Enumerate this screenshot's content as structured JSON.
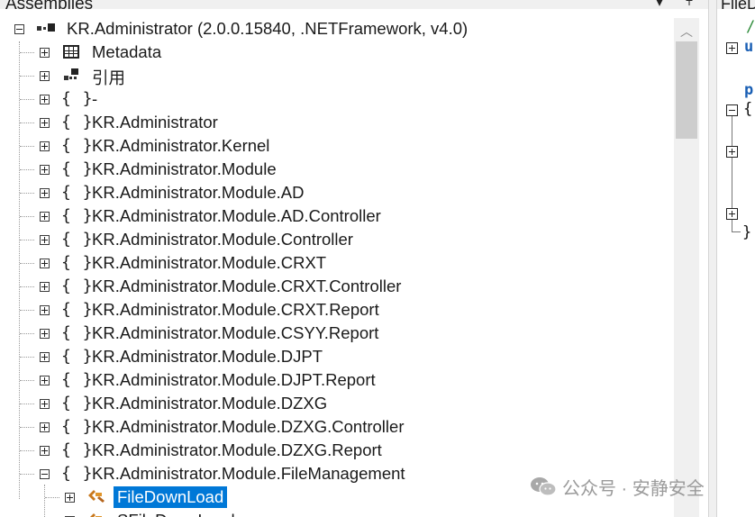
{
  "left_panel": {
    "title": "Assemblies",
    "menu_button": "▾",
    "pin_button": "📌"
  },
  "right_panel": {
    "title": "FileD",
    "code": [
      "/",
      "u",
      "p",
      "{",
      "}"
    ]
  },
  "tree": {
    "root": {
      "label": "KR.Administrator (2.0.0.15840, .NETFramework, v4.0)",
      "icon": "assembly-icon",
      "expanded": true
    },
    "children": [
      {
        "label": "Metadata",
        "icon": "metadata-icon",
        "glyph": "▥"
      },
      {
        "label": "引用",
        "icon": "references-icon",
        "glyph": "▞"
      },
      {
        "label": "-",
        "icon": "namespace-icon",
        "glyph": "{ }"
      },
      {
        "label": "KR.Administrator",
        "icon": "namespace-icon",
        "glyph": "{ }"
      },
      {
        "label": "KR.Administrator.Kernel",
        "icon": "namespace-icon",
        "glyph": "{ }"
      },
      {
        "label": "KR.Administrator.Module",
        "icon": "namespace-icon",
        "glyph": "{ }"
      },
      {
        "label": "KR.Administrator.Module.AD",
        "icon": "namespace-icon",
        "glyph": "{ }"
      },
      {
        "label": "KR.Administrator.Module.AD.Controller",
        "icon": "namespace-icon",
        "glyph": "{ }"
      },
      {
        "label": "KR.Administrator.Module.Controller",
        "icon": "namespace-icon",
        "glyph": "{ }"
      },
      {
        "label": "KR.Administrator.Module.CRXT",
        "icon": "namespace-icon",
        "glyph": "{ }"
      },
      {
        "label": "KR.Administrator.Module.CRXT.Controller",
        "icon": "namespace-icon",
        "glyph": "{ }"
      },
      {
        "label": "KR.Administrator.Module.CRXT.Report",
        "icon": "namespace-icon",
        "glyph": "{ }"
      },
      {
        "label": "KR.Administrator.Module.CSYY.Report",
        "icon": "namespace-icon",
        "glyph": "{ }"
      },
      {
        "label": "KR.Administrator.Module.DJPT",
        "icon": "namespace-icon",
        "glyph": "{ }"
      },
      {
        "label": "KR.Administrator.Module.DJPT.Report",
        "icon": "namespace-icon",
        "glyph": "{ }"
      },
      {
        "label": "KR.Administrator.Module.DZXG",
        "icon": "namespace-icon",
        "glyph": "{ }"
      },
      {
        "label": "KR.Administrator.Module.DZXG.Controller",
        "icon": "namespace-icon",
        "glyph": "{ }"
      },
      {
        "label": "KR.Administrator.Module.DZXG.Report",
        "icon": "namespace-icon",
        "glyph": "{ }"
      },
      {
        "label": "KR.Administrator.Module.FileManagement",
        "icon": "namespace-icon",
        "glyph": "{ }",
        "expanded": true
      }
    ],
    "class_items": [
      {
        "label": "FileDownLoad",
        "icon": "class-icon",
        "selected": true
      },
      {
        "label": "SFileDownLoad",
        "icon": "class-icon"
      }
    ]
  },
  "watermark": {
    "text": "公众号 · 安静安全"
  },
  "colors": {
    "selection": "#0078d7",
    "text": "#1a1a1a",
    "chrome": "#f0f0f0",
    "watermark": "#9a9a9a"
  }
}
